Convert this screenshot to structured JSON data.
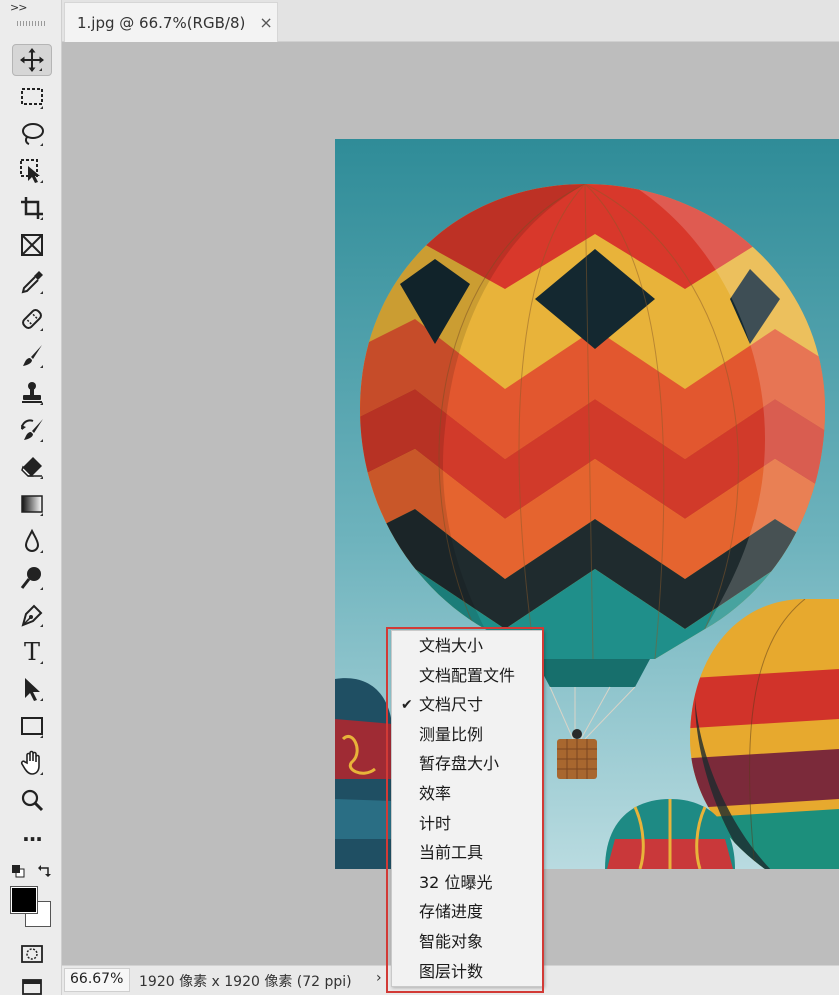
{
  "document": {
    "tab_title": "1.jpg @ 66.7%(RGB/8)",
    "close_glyph": "×"
  },
  "toolbar": {
    "collapse_glyph": ">>",
    "tools": [
      {
        "id": "move",
        "icon": "move-icon",
        "active": true
      },
      {
        "id": "marquee",
        "icon": "rect-marquee-icon"
      },
      {
        "id": "lasso",
        "icon": "lasso-icon"
      },
      {
        "id": "object-select",
        "icon": "object-select-icon"
      },
      {
        "id": "crop",
        "icon": "crop-icon"
      },
      {
        "id": "frame",
        "icon": "frame-icon"
      },
      {
        "id": "eyedropper",
        "icon": "eyedropper-icon"
      },
      {
        "id": "healing",
        "icon": "healing-brush-icon"
      },
      {
        "id": "brush",
        "icon": "brush-icon"
      },
      {
        "id": "stamp",
        "icon": "clone-stamp-icon"
      },
      {
        "id": "history-brush",
        "icon": "history-brush-icon"
      },
      {
        "id": "eraser",
        "icon": "eraser-icon"
      },
      {
        "id": "gradient",
        "icon": "gradient-icon"
      },
      {
        "id": "blur",
        "icon": "blur-icon"
      },
      {
        "id": "dodge",
        "icon": "dodge-icon"
      },
      {
        "id": "pen",
        "icon": "pen-icon"
      },
      {
        "id": "type",
        "icon": "type-icon",
        "glyph": "T"
      },
      {
        "id": "path-select",
        "icon": "path-select-icon"
      },
      {
        "id": "shape",
        "icon": "rectangle-shape-icon"
      },
      {
        "id": "hand",
        "icon": "hand-icon"
      },
      {
        "id": "zoom",
        "icon": "zoom-icon"
      },
      {
        "id": "more",
        "icon": "more-icon",
        "glyph": "···"
      }
    ],
    "foreground_color": "#000000",
    "background_color": "#ffffff"
  },
  "status": {
    "zoom": "66.67%",
    "doc_info": "1920 像素 x 1920 像素 (72 ppi)",
    "arrow": "›"
  },
  "menu": {
    "items": [
      {
        "label": "文档大小",
        "checked": false
      },
      {
        "label": "文档配置文件",
        "checked": false
      },
      {
        "label": "文档尺寸",
        "checked": true
      },
      {
        "label": "测量比例",
        "checked": false
      },
      {
        "label": "暂存盘大小",
        "checked": false
      },
      {
        "label": "效率",
        "checked": false
      },
      {
        "label": "计时",
        "checked": false
      },
      {
        "label": "当前工具",
        "checked": false
      },
      {
        "label": "32 位曝光",
        "checked": false
      },
      {
        "label": "存储进度",
        "checked": false
      },
      {
        "label": "智能对象",
        "checked": false
      },
      {
        "label": "图层计数",
        "checked": false
      }
    ],
    "check_glyph": "✔"
  },
  "colors": {
    "canvas_bg": "#bdbdbd",
    "highlight_border": "#d23a36"
  }
}
